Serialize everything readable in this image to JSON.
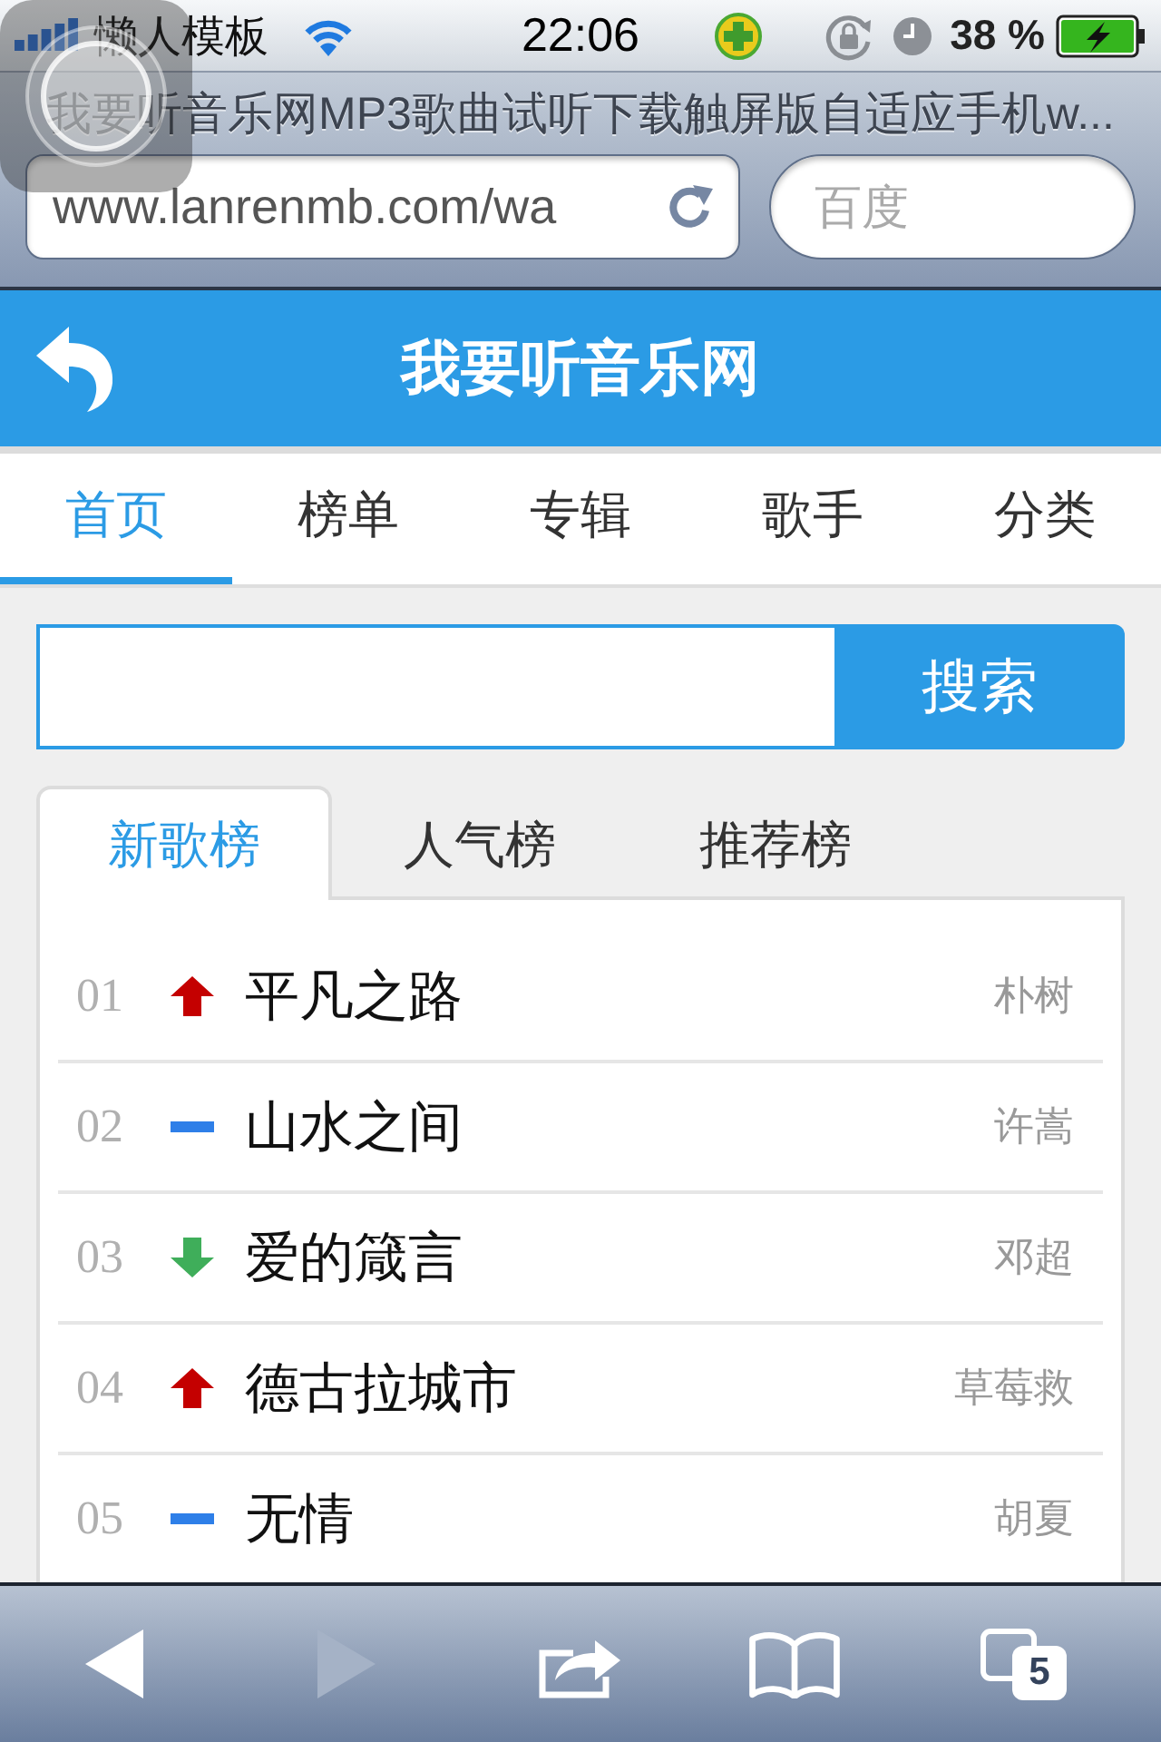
{
  "status_bar": {
    "carrier": "懒人模板",
    "time": "22:06",
    "battery": "38 %"
  },
  "browser": {
    "page_title": "我要听音乐网MP3歌曲试听下载触屏版自适应手机w...",
    "url": "www.lanrenmb.com/wa",
    "search_placeholder": "百度"
  },
  "header": {
    "title": "我要听音乐网"
  },
  "nav_tabs": [
    {
      "label": "首页",
      "selected": true
    },
    {
      "label": "榜单",
      "selected": false
    },
    {
      "label": "专辑",
      "selected": false
    },
    {
      "label": "歌手",
      "selected": false
    },
    {
      "label": "分类",
      "selected": false
    }
  ],
  "search": {
    "button": "搜索"
  },
  "chart_tabs": [
    {
      "label": "新歌榜",
      "selected": true
    },
    {
      "label": "人气榜",
      "selected": false
    },
    {
      "label": "推荐榜",
      "selected": false
    }
  ],
  "songs": [
    {
      "rank": "01",
      "kind": "up",
      "title": "平凡之路",
      "artist": "朴树"
    },
    {
      "rank": "02",
      "kind": "same",
      "title": "山水之间",
      "artist": "许嵩"
    },
    {
      "rank": "03",
      "kind": "down",
      "title": "爱的箴言",
      "artist": "邓超"
    },
    {
      "rank": "04",
      "kind": "up",
      "title": "德古拉城市",
      "artist": "草莓救"
    },
    {
      "rank": "05",
      "kind": "same",
      "title": "无情",
      "artist": "胡夏"
    }
  ],
  "toolbar": [
    {
      "kind": "back",
      "disabled": false
    },
    {
      "kind": "forward",
      "disabled": true
    },
    {
      "kind": "share",
      "disabled": false
    },
    {
      "kind": "bookmarks",
      "disabled": false
    },
    {
      "kind": "tabs",
      "disabled": false,
      "count": "5"
    }
  ]
}
